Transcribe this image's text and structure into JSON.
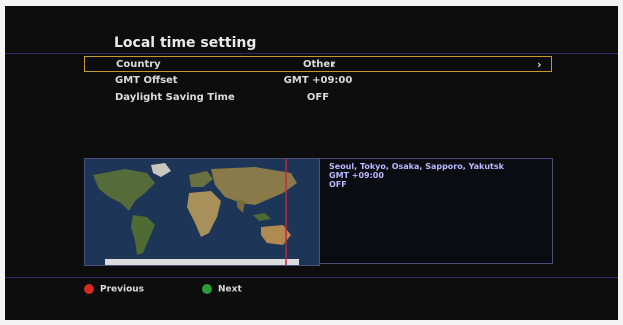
{
  "page_title": "Local time setting",
  "settings": [
    {
      "label": "Country",
      "value": "Other",
      "selected": true
    },
    {
      "label": "GMT Offset",
      "value": "GMT +09:00",
      "selected": false
    },
    {
      "label": "Daylight Saving Time",
      "value": "OFF",
      "selected": false
    }
  ],
  "arrows": {
    "left": "‹",
    "right": "›"
  },
  "info": {
    "cities": "Seoul, Tokyo, Osaka, Sapporo, Yakutsk",
    "offset": "GMT +09:00",
    "dst": "OFF"
  },
  "footer": {
    "previous": {
      "label": "Previous",
      "color": "#d42a22"
    },
    "next": {
      "label": "Next",
      "color": "#2f9a3a"
    }
  },
  "colors": {
    "selection_border": "#c79a2e",
    "timezone_marker": "#c0283a"
  }
}
